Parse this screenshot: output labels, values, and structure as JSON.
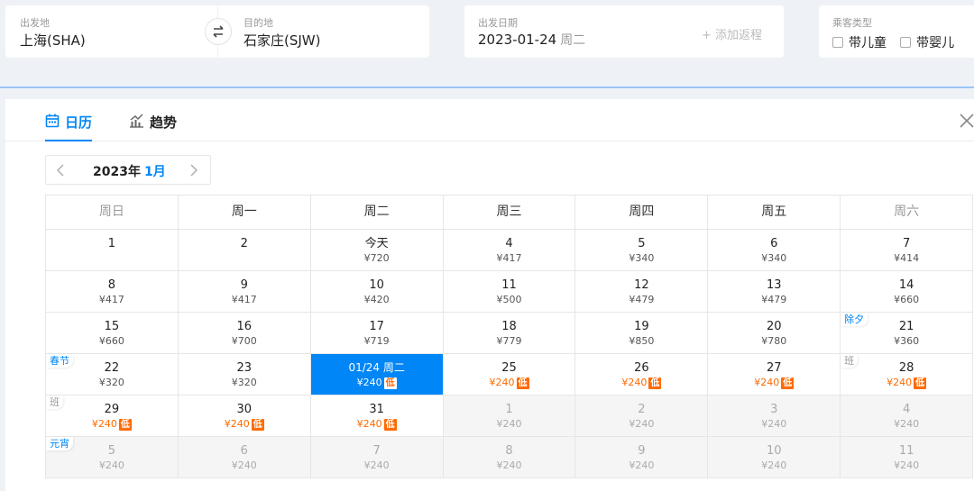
{
  "search": {
    "from_label": "出发地",
    "from_value": "上海(SHA)",
    "to_label": "目的地",
    "to_value": "石家庄(SJW)",
    "date_label": "出发日期",
    "date_value": "2023-01-24",
    "date_week": "周二",
    "add_return": "+ 添加返程",
    "pax_label": "乘客类型",
    "pax_child": "带儿童",
    "pax_infant": "带婴儿"
  },
  "tabs": {
    "calendar": "日历",
    "trend": "趋势"
  },
  "month_nav": {
    "year": "2023年",
    "month": "1月"
  },
  "weekdays": [
    "周日",
    "周一",
    "周二",
    "周三",
    "周四",
    "周五",
    "周六"
  ],
  "low_tag": "低",
  "rows": [
    [
      {
        "d": "1",
        "p": ""
      },
      {
        "d": "2",
        "p": ""
      },
      {
        "d": "今天",
        "p": "¥720"
      },
      {
        "d": "4",
        "p": "¥417"
      },
      {
        "d": "5",
        "p": "¥340"
      },
      {
        "d": "6",
        "p": "¥340"
      },
      {
        "d": "7",
        "p": "¥414"
      }
    ],
    [
      {
        "d": "8",
        "p": "¥417"
      },
      {
        "d": "9",
        "p": "¥417"
      },
      {
        "d": "10",
        "p": "¥420"
      },
      {
        "d": "11",
        "p": "¥500"
      },
      {
        "d": "12",
        "p": "¥479"
      },
      {
        "d": "13",
        "p": "¥479"
      },
      {
        "d": "14",
        "p": "¥660"
      }
    ],
    [
      {
        "d": "15",
        "p": "¥660"
      },
      {
        "d": "16",
        "p": "¥700"
      },
      {
        "d": "17",
        "p": "¥719"
      },
      {
        "d": "18",
        "p": "¥779"
      },
      {
        "d": "19",
        "p": "¥850"
      },
      {
        "d": "20",
        "p": "¥780"
      },
      {
        "d": "21",
        "p": "¥360",
        "hol": "除夕"
      }
    ],
    [
      {
        "d": "22",
        "p": "¥320",
        "hol": "春节"
      },
      {
        "d": "23",
        "p": "¥320"
      },
      {
        "d": "01/24 周二",
        "p": "¥240",
        "low": true,
        "sel": true
      },
      {
        "d": "25",
        "p": "¥240",
        "low": true
      },
      {
        "d": "26",
        "p": "¥240",
        "low": true
      },
      {
        "d": "27",
        "p": "¥240",
        "low": true
      },
      {
        "d": "28",
        "p": "¥240",
        "low": true,
        "hol": "班",
        "hol_gray": true
      }
    ],
    [
      {
        "d": "29",
        "p": "¥240",
        "low": true,
        "hol": "班",
        "hol_gray": true
      },
      {
        "d": "30",
        "p": "¥240",
        "low": true
      },
      {
        "d": "31",
        "p": "¥240",
        "low": true
      },
      {
        "d": "1",
        "p": "¥240",
        "other": true
      },
      {
        "d": "2",
        "p": "¥240",
        "other": true
      },
      {
        "d": "3",
        "p": "¥240",
        "other": true
      },
      {
        "d": "4",
        "p": "¥240",
        "other": true
      }
    ],
    [
      {
        "d": "5",
        "p": "¥240",
        "other": true,
        "hol": "元宵"
      },
      {
        "d": "6",
        "p": "¥240",
        "other": true
      },
      {
        "d": "7",
        "p": "¥240",
        "other": true
      },
      {
        "d": "8",
        "p": "¥240",
        "other": true
      },
      {
        "d": "9",
        "p": "¥240",
        "other": true
      },
      {
        "d": "10",
        "p": "¥240",
        "other": true
      },
      {
        "d": "11",
        "p": "¥240",
        "other": true
      }
    ]
  ]
}
